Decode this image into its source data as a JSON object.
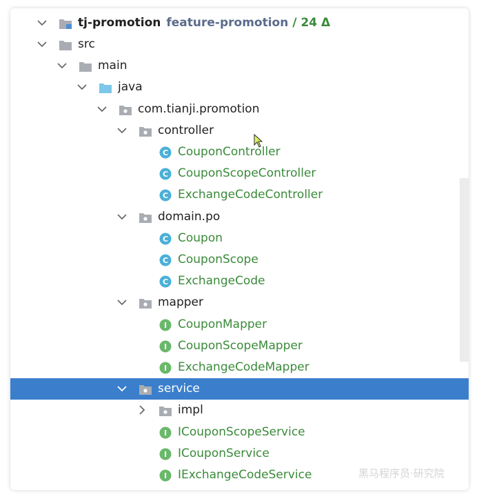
{
  "tree": {
    "root": {
      "label": "tj-promotion",
      "branch": "feature-promotion",
      "status": "/ 24 Δ"
    },
    "rows": [
      {
        "label": "src",
        "kind": "folder",
        "expanded": true,
        "green": false
      },
      {
        "label": "main",
        "kind": "folder",
        "expanded": true,
        "green": false
      },
      {
        "label": "java",
        "kind": "source-folder",
        "expanded": true,
        "green": false
      },
      {
        "label": "com.tianji.promotion",
        "kind": "package",
        "expanded": true,
        "green": false
      },
      {
        "label": "controller",
        "kind": "package",
        "expanded": true,
        "green": false
      },
      {
        "label": "CouponController",
        "kind": "class",
        "green": true
      },
      {
        "label": "CouponScopeController",
        "kind": "class",
        "green": true
      },
      {
        "label": "ExchangeCodeController",
        "kind": "class",
        "green": true
      },
      {
        "label": "domain.po",
        "kind": "package",
        "expanded": true,
        "green": false
      },
      {
        "label": "Coupon",
        "kind": "class",
        "green": true
      },
      {
        "label": "CouponScope",
        "kind": "class",
        "green": true
      },
      {
        "label": "ExchangeCode",
        "kind": "class",
        "green": true
      },
      {
        "label": "mapper",
        "kind": "package",
        "expanded": true,
        "green": false
      },
      {
        "label": "CouponMapper",
        "kind": "interface",
        "green": true
      },
      {
        "label": "CouponScopeMapper",
        "kind": "interface",
        "green": true
      },
      {
        "label": "ExchangeCodeMapper",
        "kind": "interface",
        "green": true
      },
      {
        "label": "service",
        "kind": "package",
        "expanded": true,
        "green": false,
        "selected": true
      },
      {
        "label": "impl",
        "kind": "package",
        "expanded": false,
        "green": false
      },
      {
        "label": "ICouponScopeService",
        "kind": "interface",
        "green": true
      },
      {
        "label": "ICouponService",
        "kind": "interface",
        "green": true
      },
      {
        "label": "IExchangeCodeService",
        "kind": "interface",
        "green": true
      }
    ]
  },
  "watermark": "黑马程序员·研究院",
  "colors": {
    "selection": "#3b7fcc",
    "vcs_added_green": "#3a8a3a",
    "class_icon": "#4ab0d8",
    "interface_icon": "#6ab86a",
    "folder": "#a9adb3",
    "source_folder": "#7cc7ea"
  }
}
